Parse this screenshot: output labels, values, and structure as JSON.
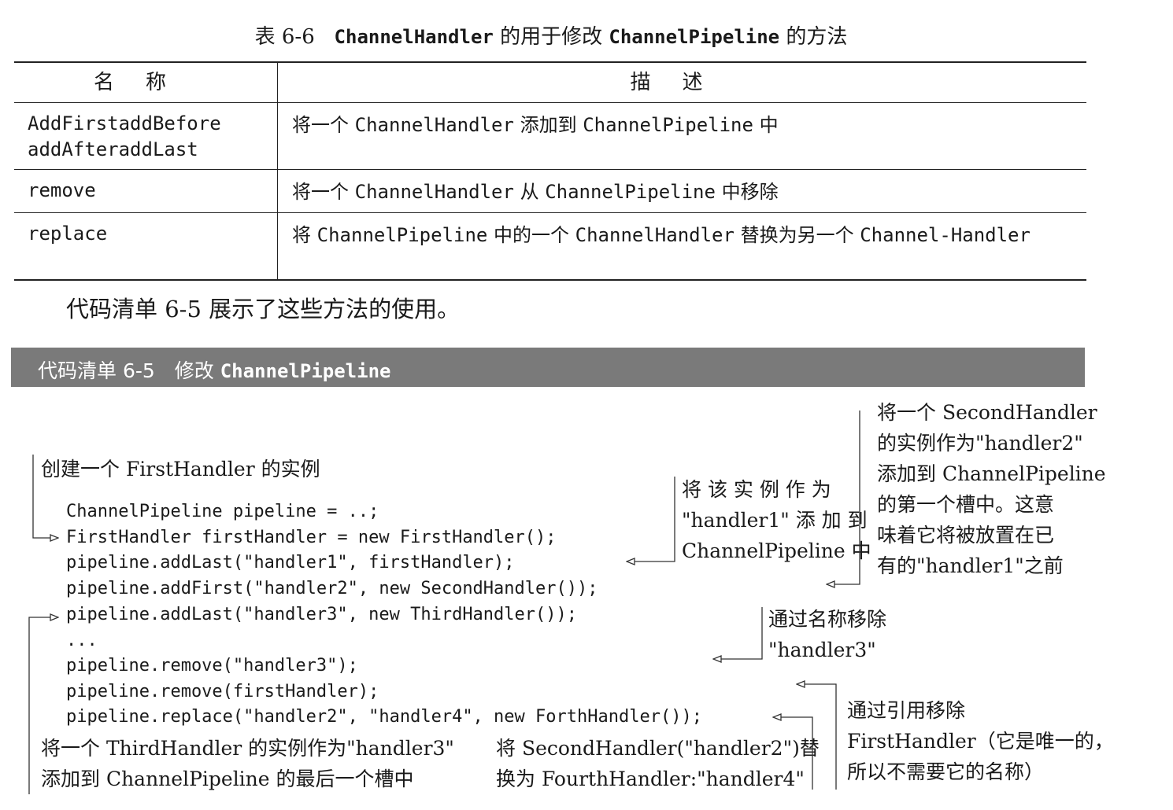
{
  "table": {
    "caption_prefix": "表 6-6",
    "caption_code1": "ChannelHandler",
    "caption_mid": " 的用于修改 ",
    "caption_code2": "ChannelPipeline",
    "caption_suffix": " 的方法",
    "header_name": "名称",
    "header_desc": "描述",
    "rows": [
      {
        "name": "AddFirstaddBefore\naddAfteraddLast",
        "desc": [
          {
            "t": "将一个 ",
            "code": false
          },
          {
            "t": "ChannelHandler",
            "code": true
          },
          {
            "t": " 添加到 ",
            "code": false
          },
          {
            "t": "ChannelPipeline",
            "code": true
          },
          {
            "t": " 中",
            "code": false
          }
        ]
      },
      {
        "name": "remove",
        "desc": [
          {
            "t": "将一个 ",
            "code": false
          },
          {
            "t": "ChannelHandler",
            "code": true
          },
          {
            "t": " 从 ",
            "code": false
          },
          {
            "t": "ChannelPipeline",
            "code": true
          },
          {
            "t": " 中移除",
            "code": false
          }
        ]
      },
      {
        "name": "replace",
        "desc": [
          {
            "t": "将 ",
            "code": false
          },
          {
            "t": "ChannelPipeline",
            "code": true
          },
          {
            "t": " 中的一个 ",
            "code": false
          },
          {
            "t": "ChannelHandler",
            "code": true
          },
          {
            "t": " 替换为另一个 ",
            "code": false
          },
          {
            "t": "Channel-Handler",
            "code": true
          }
        ]
      }
    ]
  },
  "intro_text": "代码清单 6-5 展示了这些方法的使用。",
  "listing": {
    "label": "代码清单 6-5　修改 ",
    "label_code": "ChannelPipeline",
    "code_lines": [
      "ChannelPipeline pipeline = ..;",
      "FirstHandler firstHandler = new FirstHandler();",
      "pipeline.addLast(\"handler1\", firstHandler);",
      "pipeline.addFirst(\"handler2\", new SecondHandler());",
      "pipeline.addLast(\"handler3\", new ThirdHandler());",
      "...",
      "pipeline.remove(\"handler3\");",
      "pipeline.remove(firstHandler);",
      "pipeline.replace(\"handler2\", \"handler4\", new ForthHandler());"
    ]
  },
  "annotations": {
    "create_first": "创建一个 FirstHandler 的实例",
    "add_handler1": [
      "将 该 实 例 作 为",
      "\"handler1\" 添 加 到",
      "ChannelPipeline 中"
    ],
    "add_handler2": [
      "将一个  SecondHandler",
      "的实例作为\"handler2\"",
      "添加到 ChannelPipeline",
      "的第一个槽中。这意",
      "味着它将被放置在已",
      "有的\"handler1\"之前"
    ],
    "remove_by_name": [
      "通过名称移除",
      "\"handler3\""
    ],
    "remove_by_ref": [
      "通过引用移除",
      "FirstHandler（它是唯一的，",
      "所以不需要它的名称）"
    ],
    "add_handler3": [
      "将一个 ThirdHandler 的实例作为\"handler3\"",
      "添加到 ChannelPipeline 的最后一个槽中"
    ],
    "replace_handler2": [
      "将  SecondHandler(\"handler2\")替",
      "换为 FourthHandler:\"handler4\""
    ]
  }
}
